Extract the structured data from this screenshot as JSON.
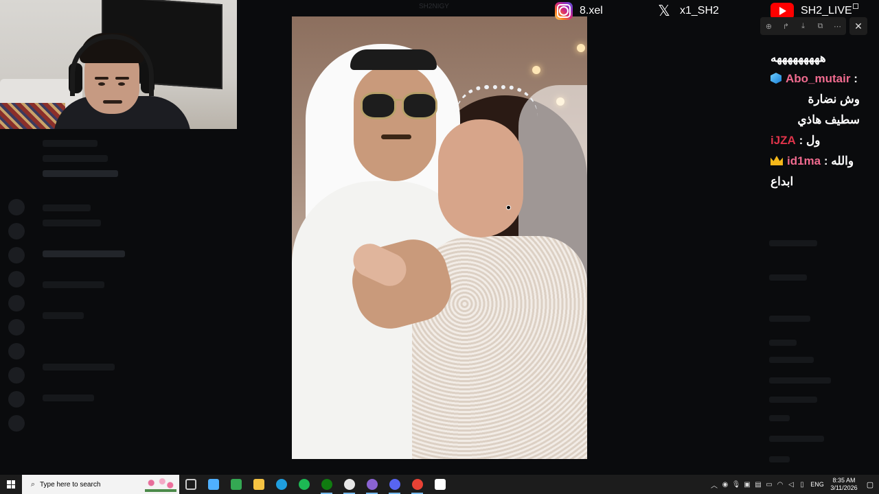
{
  "stream_overlay": {
    "socials": [
      {
        "icon": "instagram-icon",
        "handle": "8.xel"
      },
      {
        "icon": "x-icon",
        "handle": "x1_SH2"
      },
      {
        "icon": "youtube-icon",
        "handle": "SH2_LIVE"
      }
    ],
    "chat": [
      {
        "type": "text",
        "text": "هههههههههه"
      },
      {
        "type": "msg",
        "badge": "cube-icon",
        "user": "Abo_mutair",
        "sep": " :",
        "text": "وش نضارة سطيف هاذي"
      },
      {
        "type": "msg",
        "badge": "",
        "user": "iJZA",
        "sep": " : ",
        "text": "ول"
      },
      {
        "type": "msg",
        "badge": "crown-icon",
        "user": "id1ma",
        "sep": " : ",
        "text": "والله ابداع"
      }
    ]
  },
  "image_viewer": {
    "toolbar": [
      "zoom-in-icon",
      "rotate-icon",
      "download-icon",
      "open-external-icon",
      "more-icon"
    ],
    "close_icon": "close-icon",
    "background_title": "SH2NIGY"
  },
  "taskbar": {
    "search_placeholder": "Type here to search",
    "apps": [
      {
        "name": "task-view",
        "color": "#cccccc"
      },
      {
        "name": "copilot",
        "color": "#4fb0ff"
      },
      {
        "name": "play-store",
        "color": "#34a853"
      },
      {
        "name": "file-explorer",
        "color": "#f5c342"
      },
      {
        "name": "edge",
        "color": "#1f9ede"
      },
      {
        "name": "spotify",
        "color": "#1db954"
      },
      {
        "name": "xbox",
        "color": "#107c10"
      },
      {
        "name": "app-circle",
        "color": "#e6e6e6"
      },
      {
        "name": "app-purple",
        "color": "#8a63d2"
      },
      {
        "name": "discord",
        "color": "#5865f2"
      },
      {
        "name": "chrome",
        "color": "#e94235"
      },
      {
        "name": "settings",
        "color": "#ffffff"
      }
    ],
    "tray": {
      "language": "ENG",
      "time": "8:35 AM",
      "date": "3/11/2026"
    }
  }
}
